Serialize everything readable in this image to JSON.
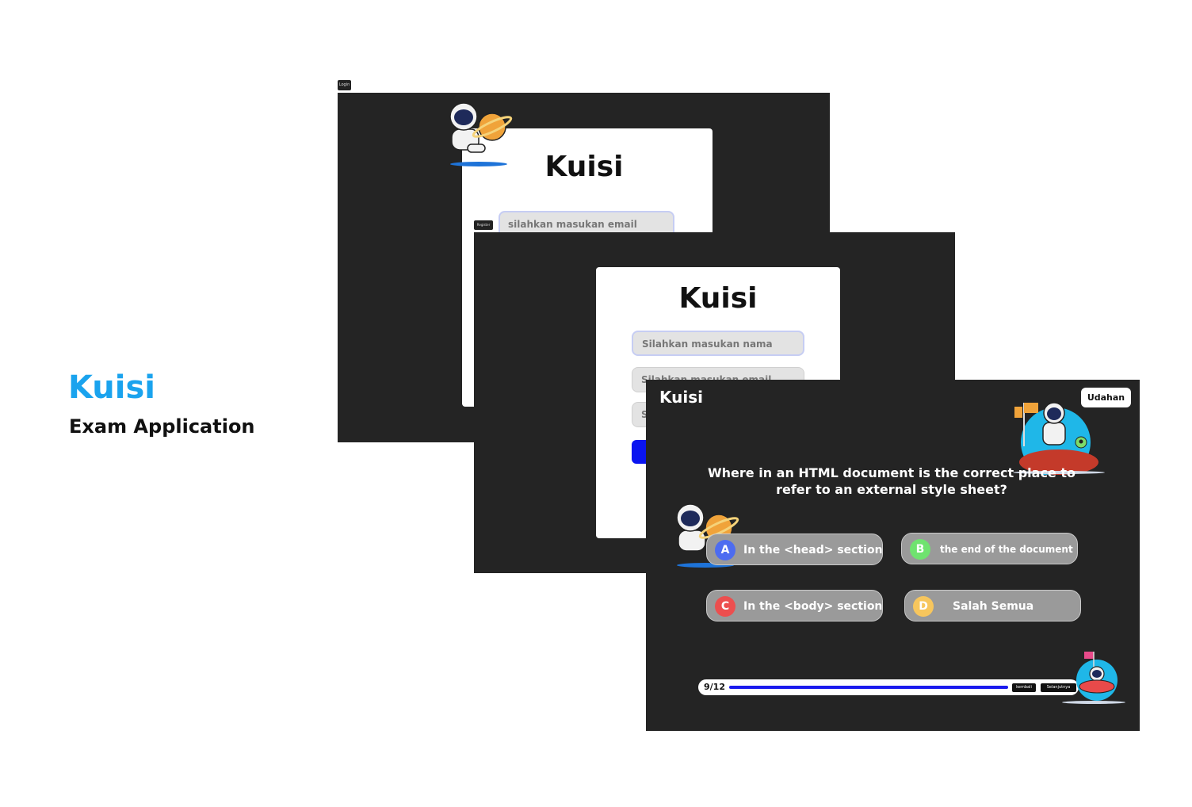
{
  "hero": {
    "title": "Kuisi",
    "subtitle": "Exam Application"
  },
  "login_screen": {
    "tag": "Login",
    "title": "Kuisi",
    "email_placeholder": "silahkan masukan email"
  },
  "register_screen": {
    "tag": "Register",
    "title": "Kuisi",
    "name_placeholder": "Silahkan masukan nama",
    "email_placeholder": "Silahkan masukan email",
    "password_placeholder": "S"
  },
  "quiz_screen": {
    "logo": "Kuisi",
    "exit_label": "Udahan",
    "question": "Where in an HTML document is the correct place to refer to an external style sheet?",
    "options": [
      {
        "letter": "A",
        "text": "In the <head> section",
        "color": "#4d6cf0"
      },
      {
        "letter": "B",
        "text": "the end of the document",
        "color": "#6fe36f"
      },
      {
        "letter": "C",
        "text": "In the <body> section",
        "color": "#ec4f4f"
      },
      {
        "letter": "D",
        "text": "Salah Semua",
        "color": "#f7c65d"
      }
    ],
    "progress": {
      "label": "9/12",
      "current": 9,
      "total": 12
    },
    "back_label": "kembali",
    "next_label": "Selanjutnya"
  },
  "colors": {
    "brand": "#1aa3ee",
    "screen_bg": "#242424",
    "primary_button": "#0a14f0"
  }
}
